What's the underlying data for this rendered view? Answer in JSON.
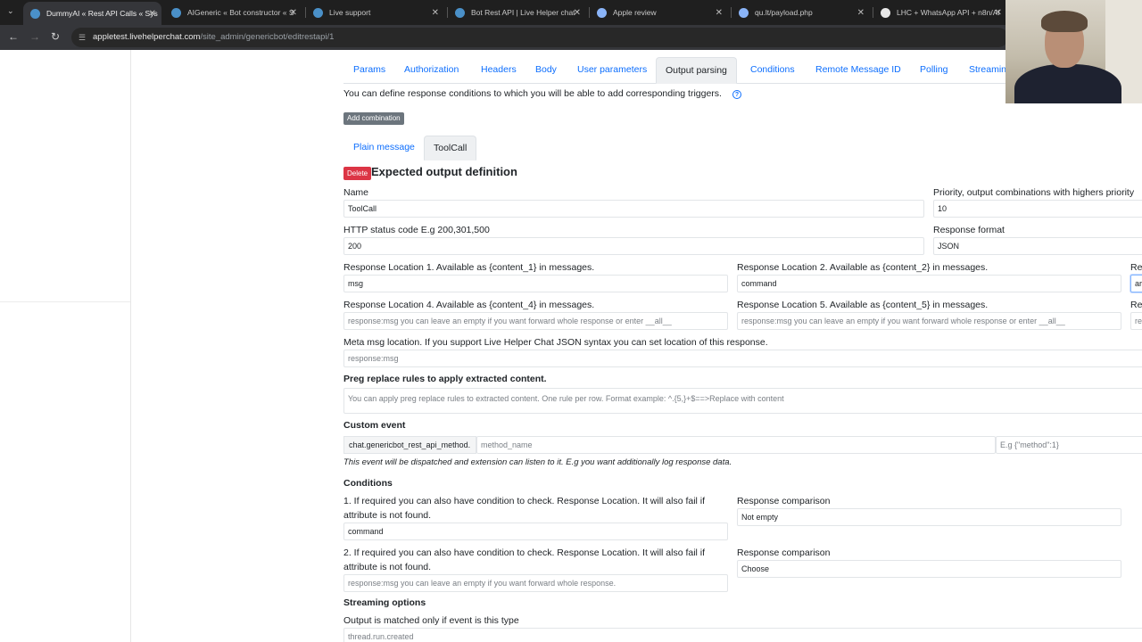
{
  "browser": {
    "tabs": [
      {
        "title": "DummyAI « Rest API Calls « Sys",
        "active": true,
        "icon": "lhc-icon"
      },
      {
        "title": "AIGeneric « Bot constructor « S",
        "active": false,
        "icon": "lhc-icon"
      },
      {
        "title": "Live support",
        "active": false,
        "icon": "lhc-icon"
      },
      {
        "title": "Bot Rest API | Live Helper chat",
        "active": false,
        "icon": "lhc-icon"
      },
      {
        "title": "Apple review",
        "active": false,
        "icon": "globe-icon"
      },
      {
        "title": "qu.lt/payload.php",
        "active": false,
        "icon": "globe-icon"
      },
      {
        "title": "LHC + WhatsApp API + n8n/AI",
        "active": false,
        "icon": "github-icon"
      }
    ],
    "url_host": "appletest.livehelperchat.com",
    "url_path": "/site_admin/genericbot/editrestapi/1"
  },
  "main_tabs": [
    "Params",
    "Authorization",
    "Headers",
    "Body",
    "User parameters",
    "Output parsing",
    "Conditions",
    "Remote Message ID",
    "Polling",
    "Streamin"
  ],
  "main_tabs_active": "Output parsing",
  "intro_text": "You can define response conditions to which you will be able to add corresponding triggers.",
  "add_combination_label": "Add combination",
  "sub_tabs": [
    "Plain message",
    "ToolCall"
  ],
  "sub_tabs_active": "ToolCall",
  "delete_label": "Delete",
  "section_title": "Expected output definition",
  "fields": {
    "name_label": "Name",
    "name_value": "ToolCall",
    "priority_label": "Priority, output combinations with highers priority",
    "priority_value": "10",
    "http_label": "HTTP status code E.g 200,301,500",
    "http_value": "200",
    "format_label": "Response format",
    "format_value": "JSON",
    "loc1_label": "Response Location 1. Available as {content_1} in messages.",
    "loc1_value": "msg",
    "loc2_label": "Response Location 2. Available as {content_2} in messages.",
    "loc2_value": "command",
    "loc3_label": "Re",
    "loc3_value": "ar",
    "loc4_label": "Response Location 4. Available as {content_4} in messages.",
    "loc4_placeholder": "response:msg you can leave an empty if you want forward whole response or enter __all__",
    "loc5_label": "Response Location 5. Available as {content_5} in messages.",
    "loc5_placeholder": "response:msg you can leave an empty if you want forward whole response or enter __all__",
    "loc6_label": "Re",
    "loc6_placeholder": "re",
    "meta_label": "Meta msg location. If you support Live Helper Chat JSON syntax you can set location of this response.",
    "meta_placeholder": "response:msg",
    "preg_label": "Preg replace rules to apply extracted content.",
    "preg_placeholder": "You can apply preg replace rules to extracted content. One rule per row. Format example: ^.{5,}+$==>Replace with content",
    "custom_event_label": "Custom event",
    "custom_event_prefix": "chat.genericbot_rest_api_method.",
    "custom_event_placeholder": "method_name",
    "custom_event_example_placeholder": "E.g {\"method\":1}",
    "custom_event_help": "This event will be dispatched and extension can listen to it. E.g you want additionally log response data.",
    "conditions_label": "Conditions",
    "cond1_label_line1": "1. If required you can also have condition to check. Response Location. It will also fail if",
    "cond1_label_line2": "attribute is not found.",
    "cond1_value": "command",
    "cond1_comparison_label": "Response comparison",
    "cond1_comparison_value": "Not empty",
    "cond2_label_line1": "2. If required you can also have condition to check. Response Location. It will also fail if",
    "cond2_label_line2": "attribute is not found.",
    "cond2_placeholder": "response:msg you can leave an empty if you want forward whole response.",
    "cond2_comparison_label": "Response comparison",
    "cond2_comparison_value": "Choose",
    "streaming_label": "Streaming options",
    "streaming_event_label": "Output is matched only if event is this type",
    "streaming_event_placeholder": "thread.run.created"
  },
  "colors": {
    "link": "#0d6efd",
    "danger": "#dc3545",
    "secondary": "#6c757d",
    "chrome_dark": "#35363a"
  }
}
